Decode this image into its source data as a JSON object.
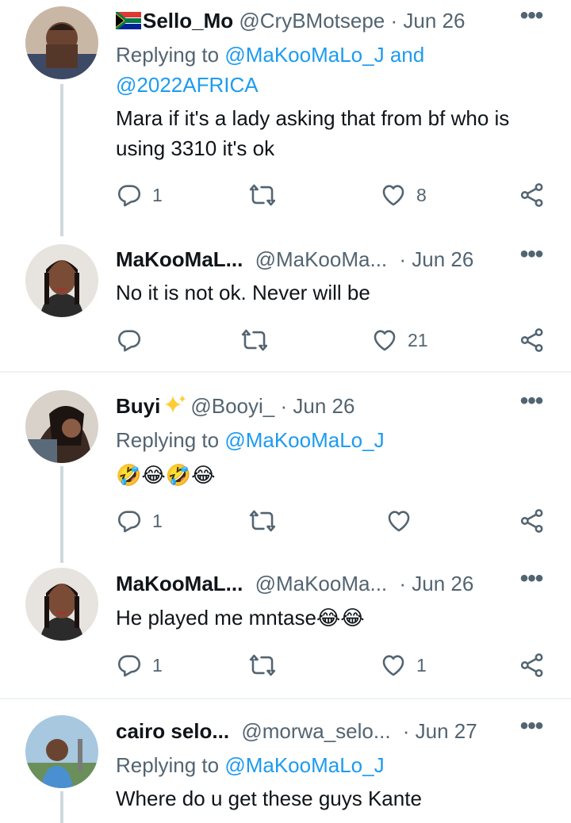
{
  "icons": {
    "reply": "reply-icon",
    "retweet": "retweet-icon",
    "like": "heart-icon",
    "share": "share-icon",
    "more": "more-dots-icon"
  },
  "colors": {
    "link": "#1d9bf0",
    "muted": "#536471",
    "thread_line": "#cfd9de"
  },
  "tweets": [
    {
      "display_name": "Sello_Mo",
      "handle": "@CryBMotsepe",
      "date": "· Jun 26",
      "replying_prefix": "Replying to",
      "replying_to": "@MaKooMaLo_J",
      "replying_and": "and",
      "replying_to_2": "@2022AFRICA",
      "text": "Mara if it's a lady asking that from bf who is using 3310 it's ok",
      "replies": "1",
      "retweets": "",
      "likes": "8"
    },
    {
      "display_name": "MaKooMaL...",
      "handle": "@MaKooMa...",
      "date": "· Jun 26",
      "text": "No it is not ok. Never will be",
      "replies": "",
      "retweets": "",
      "likes": "21"
    },
    {
      "display_name": "Buyi",
      "handle": "@Booyi_",
      "date": "· Jun 26",
      "replying_prefix": "Replying to",
      "replying_to": "@MaKooMaLo_J",
      "text": "🤣😂🤣😂",
      "replies": "1",
      "retweets": "",
      "likes": ""
    },
    {
      "display_name": "MaKooMaL...",
      "handle": "@MaKooMa...",
      "date": "· Jun 26",
      "text": "He played me mntase😂😂",
      "replies": "1",
      "retweets": "",
      "likes": "1"
    },
    {
      "display_name": "cairo selo...",
      "handle": "@morwa_selo...",
      "date": "· Jun 27",
      "replying_prefix": "Replying to",
      "replying_to": "@MaKooMaLo_J",
      "text": "Where do u get these guys Kante"
    }
  ]
}
